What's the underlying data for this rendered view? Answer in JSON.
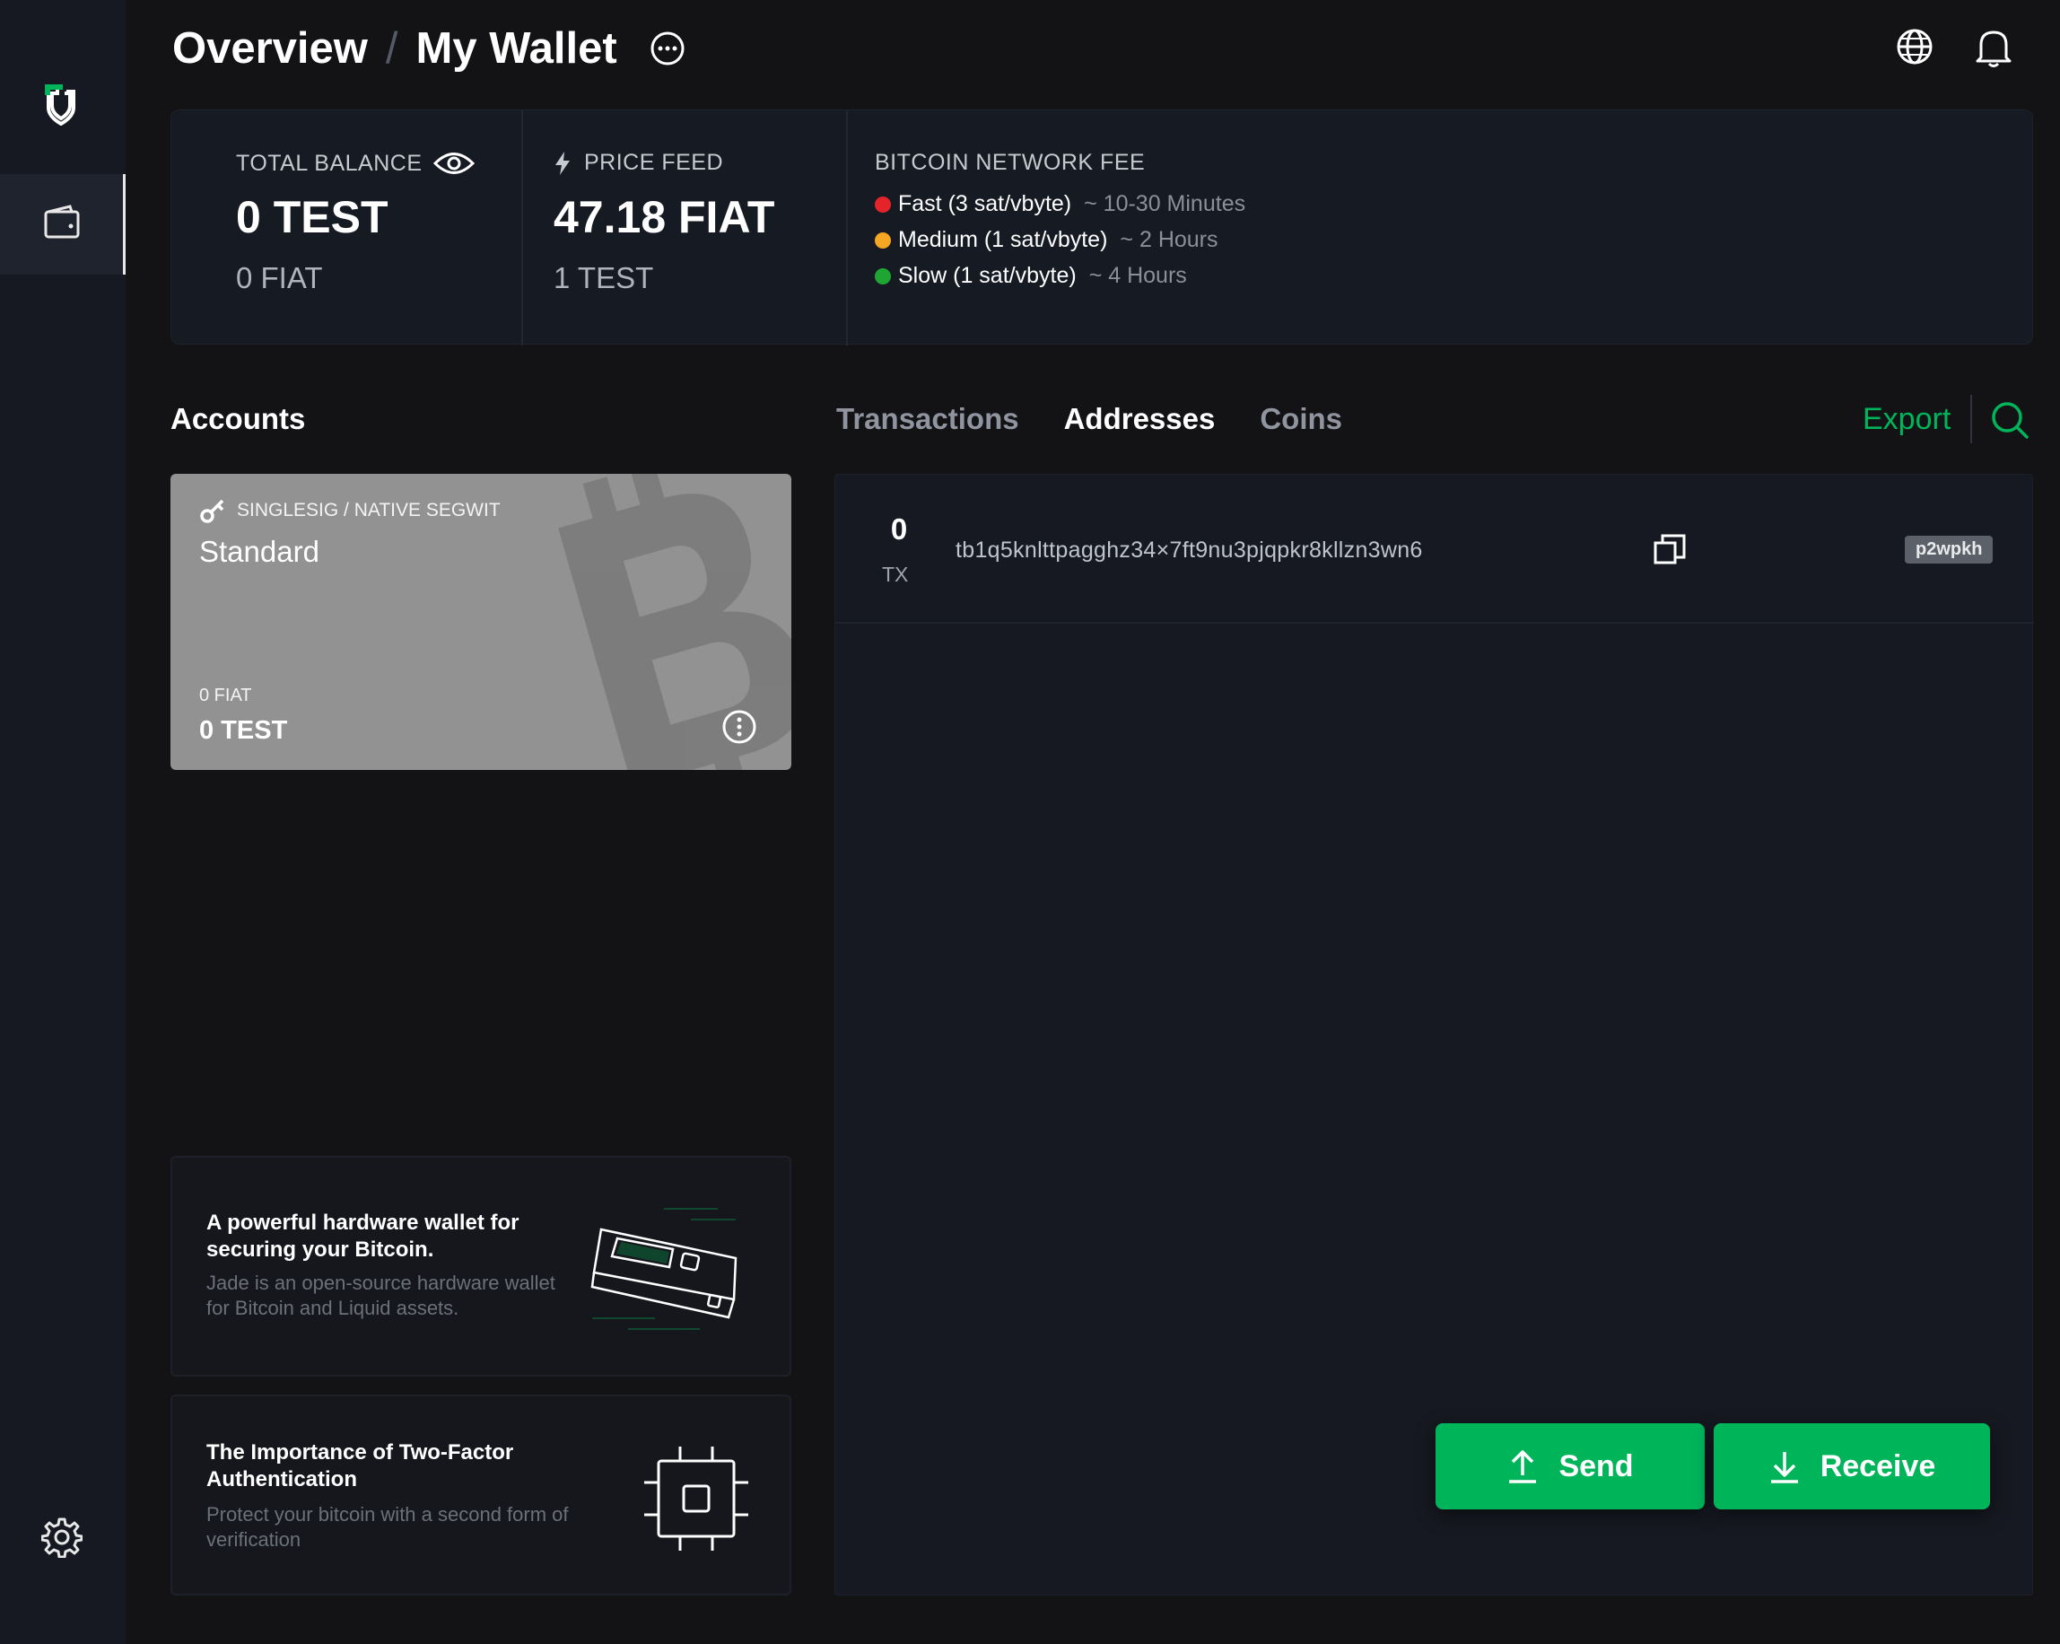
{
  "header": {
    "title": "Overview",
    "separator": "/",
    "subtitle": "My Wallet"
  },
  "summary": {
    "total_balance": {
      "label": "TOTAL BALANCE",
      "value": "0 TEST",
      "fiat": "0 FIAT"
    },
    "price_feed": {
      "label": "PRICE FEED",
      "value": "47.18 FIAT",
      "unit": "1 TEST"
    },
    "network_fee": {
      "label": "BITCOIN NETWORK FEE",
      "rows": [
        {
          "name": "Fast (3 sat/vbyte)",
          "time": "~ 10-30 Minutes",
          "color": "#e5242a"
        },
        {
          "name": "Medium (1 sat/vbyte)",
          "time": "~ 2 Hours",
          "color": "#f5a623"
        },
        {
          "name": "Slow (1 sat/vbyte)",
          "time": "~ 4 Hours",
          "color": "#1fa532"
        }
      ]
    }
  },
  "accounts": {
    "title": "Accounts",
    "card": {
      "type": "SINGLESIG / NATIVE SEGWIT",
      "name": "Standard",
      "fiat": "0 FIAT",
      "balance": "0 TEST"
    }
  },
  "tabs": [
    "Transactions",
    "Addresses",
    "Coins"
  ],
  "active_tab": "Addresses",
  "export_label": "Export",
  "addresses": [
    {
      "tx_count": "0",
      "tx_label": "TX",
      "address": "tb1q5knlttpagghz34×7ft9nu3pjqpkr8kllzn3wn6",
      "type": "p2wpkh"
    }
  ],
  "promos": [
    {
      "title": "A powerful hardware wallet for securing your Bitcoin.",
      "description": "Jade is an open-source hardware wallet for Bitcoin and Liquid assets."
    },
    {
      "title": "The Importance of Two-Factor Authentication",
      "description": "Protect your bitcoin with a second form of verification"
    }
  ],
  "actions": {
    "send": "Send",
    "receive": "Receive"
  },
  "colors": {
    "accent": "#00b45a",
    "background": "#131316",
    "panel": "#161921"
  },
  "icons": [
    "green-shield-logo-icon",
    "wallet-icon",
    "settings-gear-icon",
    "more-dots-icon",
    "globe-icon",
    "bell-icon",
    "eye-icon",
    "lightning-icon",
    "search-icon",
    "key-icon",
    "bitcoin-watermark-icon",
    "kebab-menu-icon",
    "copy-icon",
    "upload-arrow-icon",
    "download-arrow-icon",
    "jade-device-icon",
    "chip-icon"
  ]
}
